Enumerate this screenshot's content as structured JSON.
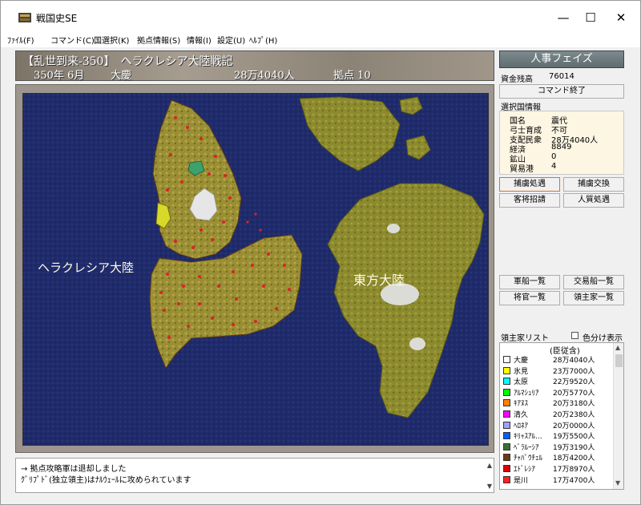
{
  "window": {
    "title": "戦国史SE",
    "min_glyph": "—",
    "max_glyph": "☐",
    "close_glyph": "✕"
  },
  "menu": [
    "ﾌｧｲﾙ(F)",
    "コマンド(C)",
    "国選択(K)",
    "拠点情報(S)",
    "情報(I)",
    "設定(U)",
    "ﾍﾙﾌﾟ(H)"
  ],
  "header": {
    "scenario": "【乱世到来-350】　ヘラクレシア大陸戦記",
    "date": "350年 6月",
    "faction": "大慶",
    "population": "28万4040人",
    "bases": "拠点 10"
  },
  "map": {
    "label_west": "ヘラクレシア大陸",
    "label_east": "東方大陸"
  },
  "log": {
    "line1": "→ 拠点攻略軍は退却しました",
    "line2": "ｸﾞﾘﾌﾟﾄﾞ(独立領主)はﾅﾙｳｪｰﾙに攻められています"
  },
  "side": {
    "phase": "人事フェイズ",
    "funds_label": "資金残高",
    "funds_value": "76014",
    "end_command": "コマンド終了",
    "info_title": "選択国情報",
    "info": [
      {
        "k": "国名",
        "v": "震代"
      },
      {
        "k": "弓士育成",
        "v": "不可"
      },
      {
        "k": "支配民衆",
        "v": "28万4040人"
      },
      {
        "k": "経済",
        "v": "8849"
      },
      {
        "k": "鉱山",
        "v": "0"
      },
      {
        "k": "貿易港",
        "v": "4"
      }
    ],
    "btn_captive_treat": "捕虜処遇",
    "btn_captive_exchange": "捕虜交換",
    "btn_guest_recruit": "客将招請",
    "btn_hostage": "人質処遇",
    "btn_warships": "軍船一覧",
    "btn_tradeships": "交易船一覧",
    "btn_generals": "将官一覧",
    "btn_lords": "領主家一覧",
    "lords_title": "領主家リスト",
    "color_toggle": "色分け表示",
    "lords_header": "(臣従含)",
    "lords": [
      {
        "name": "大慶",
        "pop": "28万4040人",
        "color": "#ffffff"
      },
      {
        "name": "氷見",
        "pop": "23万7000人",
        "color": "#ffff00"
      },
      {
        "name": "太原",
        "pop": "22万9520人",
        "color": "#00ffff"
      },
      {
        "name": "ｱﾙﾏｼｭﾘｱ",
        "pop": "20万5770人",
        "color": "#00ff00"
      },
      {
        "name": "ｷｱﾇｽ",
        "pop": "20万3180人",
        "color": "#ff8000"
      },
      {
        "name": "清久",
        "pop": "20万2380人",
        "color": "#ff00ff"
      },
      {
        "name": "ﾍﾛﾈｱ",
        "pop": "20万0000人",
        "color": "#a0a0ff"
      },
      {
        "name": "ｷﾘｬｽｱﾙ...",
        "pop": "19万5500人",
        "color": "#0060ff"
      },
      {
        "name": "ﾍﾞﾗﾙｰｼｱ",
        "pop": "19万3190人",
        "color": "#3a6e3a"
      },
      {
        "name": "ﾁｬﾊﾟｳﾁｪﾙ",
        "pop": "18万4200人",
        "color": "#6b3a12"
      },
      {
        "name": "ｴﾄﾞﾚｼｱ",
        "pop": "17万8970人",
        "color": "#e00000"
      },
      {
        "name": "是川",
        "pop": "17万4700人",
        "color": "#ff2020"
      }
    ]
  }
}
